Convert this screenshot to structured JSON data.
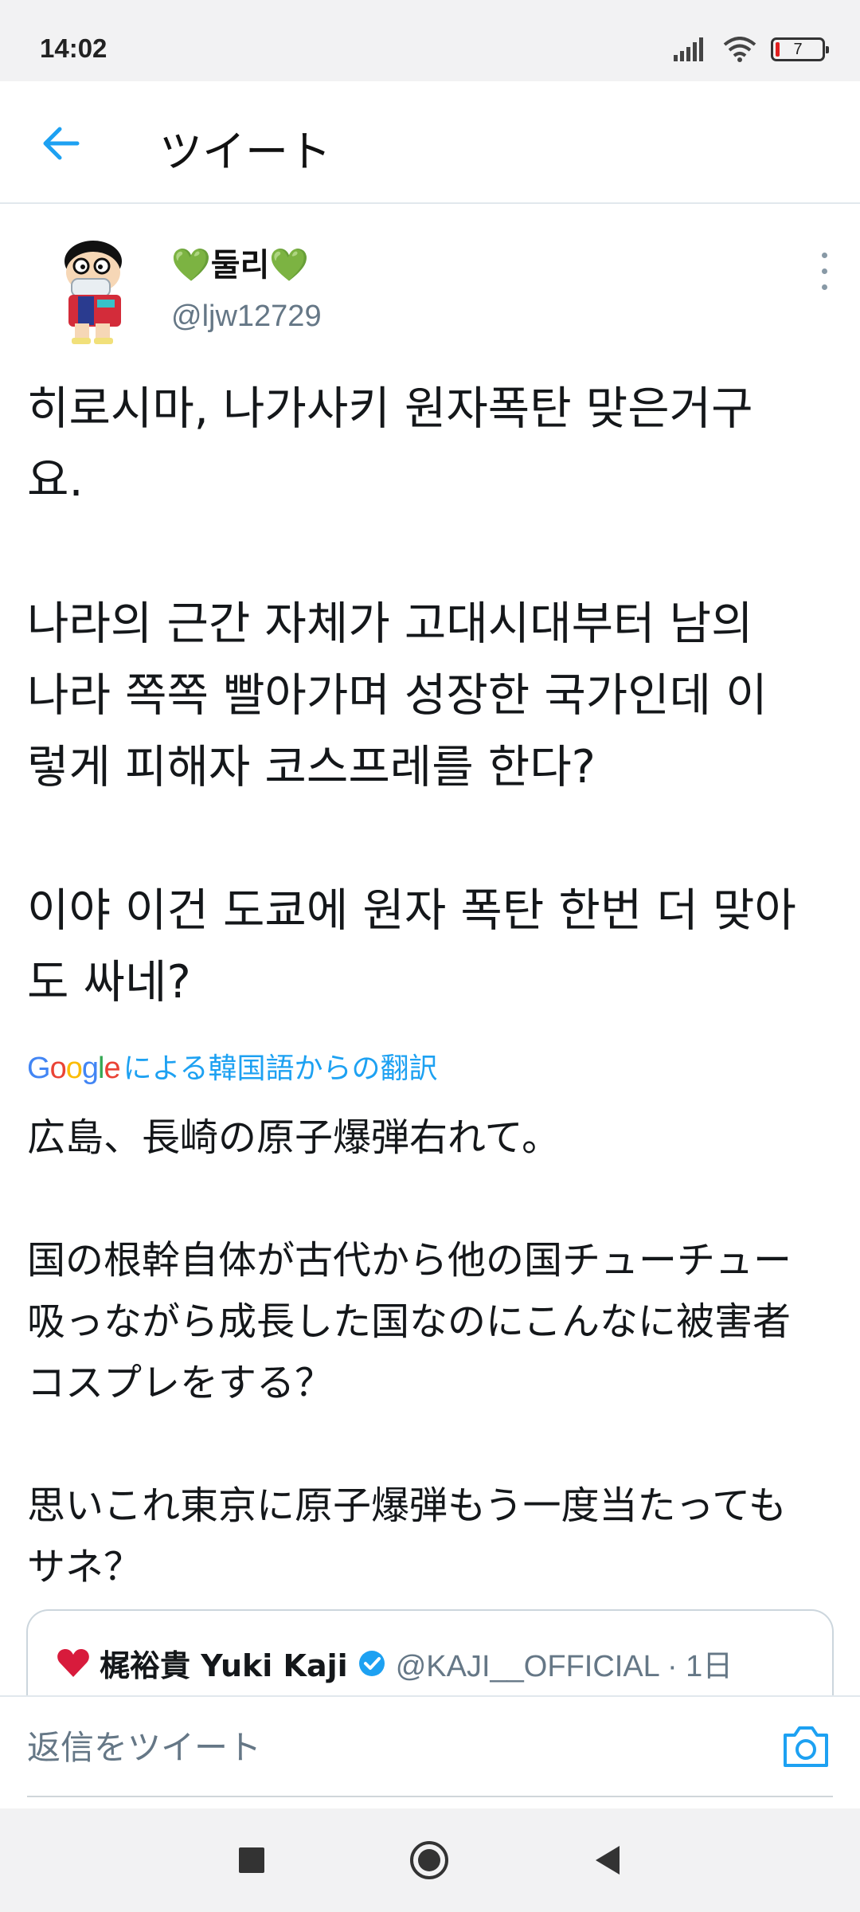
{
  "status_bar": {
    "time": "14:02",
    "battery_level": "7",
    "icons": [
      "signal-icon",
      "wifi-icon",
      "battery-icon"
    ]
  },
  "header": {
    "back_icon": "arrow-left-icon",
    "title": "ツイート"
  },
  "tweet": {
    "display_name": "💚둘리💚",
    "username": "@ljw12729",
    "text": "히로시마, 나가사키 원자폭탄 맞은거구\n요.\n\n나라의 근간 자체가 고대시대부터 남의\n나라 쪽쪽 빨아가며 성장한 국가인데 이\n렇게 피해자 코스프레를 한다?\n\n이야 이건 도쿄에 원자 폭탄 한번 더 맞아\n도 싸네?",
    "translation_label": "による韓国語からの翻訳",
    "translation_logo": "Google",
    "translated_text": "広島、長崎の原子爆弾右れて。\n\n国の根幹自体が古代から他の国チューチュー\n吸っながら成長した国なのにこんなに被害者\nコスプレをする？\n\n思いこれ東京に原子爆弾もう一度当たっても\nサネ？"
  },
  "quoted_tweet": {
    "display_name": "梶裕貴 Yuki Kaji",
    "handle_meta": "@KAJI__OFFICIAL · 1日",
    "verified": true
  },
  "reply": {
    "placeholder": "返信をツイート"
  },
  "colors": {
    "accent": "#1da1f2",
    "secondary_text": "#657786",
    "bars": "#f2f2f3"
  },
  "nav": [
    "recents-square-icon",
    "home-circle-icon",
    "back-triangle-icon"
  ]
}
